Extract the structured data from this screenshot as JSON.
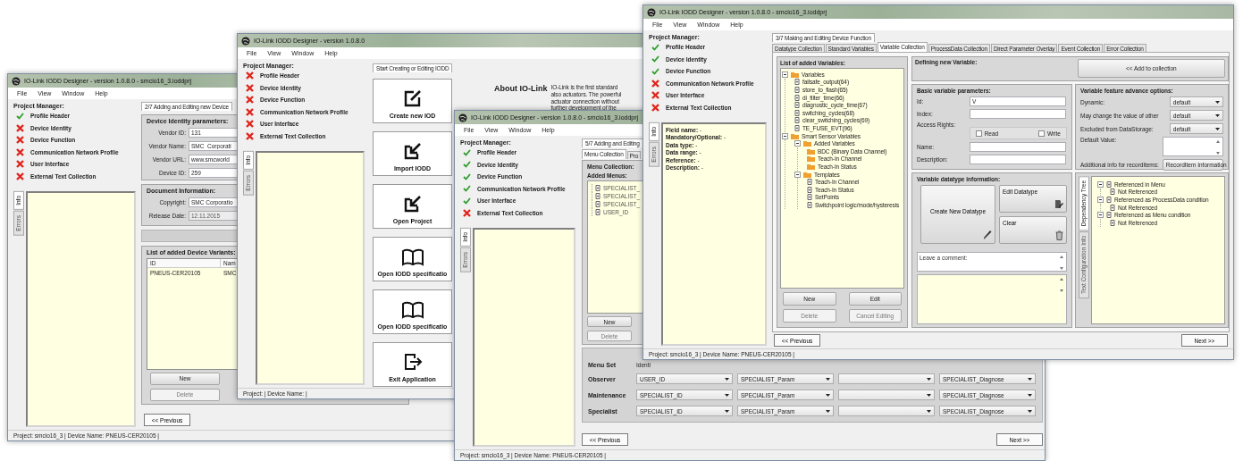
{
  "windows": [
    {
      "kind": "device_identity",
      "title": "IO-Link IODD Designer - version 1.0.8.0 - smcio16_3.ioddprj",
      "menu": [
        "File",
        "View",
        "Window",
        "Help"
      ],
      "project_manager": {
        "heading": "Project Manager:",
        "items": [
          {
            "label": "Profile Header",
            "done": true
          },
          {
            "label": "Device Identity",
            "done": false
          },
          {
            "label": "Device Function",
            "done": false
          },
          {
            "label": "Communication Network Profile",
            "done": false
          },
          {
            "label": "User Interface",
            "done": false
          },
          {
            "label": "External Text Collection",
            "done": false
          }
        ]
      },
      "side_tabs": [
        {
          "label": "Info",
          "selected": true
        },
        {
          "label": "Errors",
          "selected": false
        }
      ],
      "step": "2/7 Adding and Editing new Device",
      "identity": {
        "heading": "Device Identity parameters:",
        "fields": [
          {
            "label": "Vendor ID:",
            "value": "131",
            "disabled": false
          },
          {
            "label": "Vendor Name:",
            "value": "SMC_Corporati",
            "disabled": false
          },
          {
            "label": "Vendor URL:",
            "value": "www.smcworld",
            "disabled": false
          },
          {
            "label": "Device ID:",
            "value": "259",
            "disabled": false
          }
        ]
      },
      "document": {
        "heading": "Document Information:",
        "fields": [
          {
            "label": "Copyright:",
            "value": "SMC Corporatio",
            "disabled": false
          },
          {
            "label": "Release Date:",
            "value": "12.11.2015",
            "disabled": true
          }
        ]
      },
      "variants": {
        "heading": "List of added Device Variants:",
        "columns": [
          "ID",
          "Nam"
        ],
        "rows": [
          [
            "PNEUS-CER20105",
            "SMC"
          ]
        ]
      },
      "buttons": [
        {
          "label": "New",
          "disabled": false
        },
        {
          "label": "Delete",
          "disabled": true
        }
      ],
      "previous": "<< Previous",
      "status": "Project: smcio16_3 | Device Name: PNEUS-CER20105 |"
    },
    {
      "kind": "start",
      "title": "IO-Link IODD Designer - version 1.0.8.0",
      "menu": [
        "File",
        "View",
        "Window",
        "Help"
      ],
      "project_manager": {
        "heading": "Project Manager:",
        "items": [
          {
            "label": "Profile Header",
            "done": false
          },
          {
            "label": "Device Identity",
            "done": false
          },
          {
            "label": "Device Function",
            "done": false
          },
          {
            "label": "Communication Network Profile",
            "done": false
          },
          {
            "label": "User Interface",
            "done": false
          },
          {
            "label": "External Text Collection",
            "done": false
          }
        ]
      },
      "side_tabs": [
        {
          "label": "Info",
          "selected": true
        },
        {
          "label": "Errors",
          "selected": false
        }
      ],
      "tab": "Start Creating or Editing IODD",
      "actions": [
        "Create new IOD",
        "Import IODD",
        "Open Project",
        "Open IODD specificatio",
        "Open IODD specificatio",
        "Exit Application"
      ],
      "about": {
        "heading": "About IO-Link",
        "lines": [
          "IO-Link is the first standard",
          "also actuators. The powerful",
          "actuator connection without",
          "further development of the"
        ]
      },
      "status": "Project: | Device Name: |"
    },
    {
      "kind": "menu_collection",
      "title": "IO-Link IODD Designer - version 1.0.8.0 - smcio16_3.ioddprj",
      "menu": [
        "File",
        "View",
        "Window",
        "Help"
      ],
      "project_manager": {
        "heading": "Project Manager:",
        "items": [
          {
            "label": "Profile Header",
            "done": true
          },
          {
            "label": "Device Identity",
            "done": true
          },
          {
            "label": "Device Function",
            "done": true
          },
          {
            "label": "Communication Network Profile",
            "done": true
          },
          {
            "label": "User Interface",
            "done": true
          },
          {
            "label": "External Text Collection",
            "done": false
          }
        ]
      },
      "side_tabs": [
        {
          "label": "Info",
          "selected": true
        },
        {
          "label": "Errors",
          "selected": false
        }
      ],
      "step": "5/7 Adding and Editing",
      "tabs": [
        {
          "label": "Menu Collection",
          "selected": true
        },
        {
          "label": "Pro",
          "selected": false
        }
      ],
      "collection": {
        "heading": "Menu Collection:",
        "subheading": "Added Menus:",
        "items": [
          "SPECIALIST_",
          "SPECIALIST_",
          "SPECIALIST_",
          "USER_ID"
        ]
      },
      "buttons": [
        {
          "label": "New",
          "disabled": false
        },
        {
          "label": "Delete",
          "disabled": true
        }
      ],
      "menu_set": {
        "heading": "Menu Set",
        "column": "Identi",
        "rows": [
          {
            "role": "Observer",
            "selections": [
              {
                "kind": "value",
                "value": "USER_ID"
              },
              {
                "kind": "value",
                "value": "SPECIALIST_Param"
              },
              {
                "kind": "blank"
              },
              {
                "kind": "value",
                "value": "SPECIALIST_Diagnose"
              }
            ]
          },
          {
            "role": "Maintenance",
            "selections": [
              {
                "kind": "value",
                "value": "SPECIALIST_ID"
              },
              {
                "kind": "value",
                "value": "SPECIALIST_Param"
              },
              {
                "kind": "blank"
              },
              {
                "kind": "value",
                "value": "SPECIALIST_Diagnose"
              }
            ]
          },
          {
            "role": "Specialist",
            "selections": [
              {
                "kind": "value",
                "value": "SPECIALIST_ID"
              },
              {
                "kind": "value",
                "value": "SPECIALIST_Param"
              },
              {
                "kind": "blank"
              },
              {
                "kind": "value",
                "value": "SPECIALIST_Diagnose"
              }
            ]
          }
        ]
      },
      "previous": "<< Previous",
      "next": "Next >>",
      "status": "Project: smcio16_3 | Device Name: PNEUS-CER20105 |"
    },
    {
      "kind": "variable_collection",
      "title": "IO-Link IODD Designer - version 1.0.8.0 - smcio16_3.ioddprj",
      "menu": [
        "File",
        "View",
        "Window",
        "Help"
      ],
      "project_manager": {
        "heading": "Project Manager:",
        "items": [
          {
            "label": "Profile Header",
            "done": true
          },
          {
            "label": "Device Identity",
            "done": true
          },
          {
            "label": "Device Function",
            "done": true
          },
          {
            "label": "Communication Network Profile",
            "done": false
          },
          {
            "label": "User Interface",
            "done": false
          },
          {
            "label": "External Text Collection",
            "done": false
          }
        ]
      },
      "side_tabs": [
        {
          "label": "Info",
          "selected": true
        },
        {
          "label": "Errors",
          "selected": false
        }
      ],
      "info_lines": [
        "**Field name:** -",
        "**Mandatory/Optional:** -",
        "**Data type:** -",
        "**Data range:** -",
        "**Reference:** -",
        "**Description:** -"
      ],
      "step": "3/7 Making and Editing Device Function",
      "tabs": [
        {
          "label": "Datatype Collection",
          "selected": false
        },
        {
          "label": "Standard Variables",
          "selected": false
        },
        {
          "label": "Variable Collection",
          "selected": true
        },
        {
          "label": "ProcessData Collection",
          "selected": false
        },
        {
          "label": "Direct Parameter Overlay",
          "selected": false
        },
        {
          "label": "Event Collection",
          "selected": false
        },
        {
          "label": "Error Collection",
          "selected": false
        }
      ],
      "variables": {
        "heading": "List of added Variables:",
        "tree": [
          {
            "kind": "folder",
            "label": "Variables",
            "children": [
              {
                "kind": "item",
                "label": "failsafe_output(64)"
              },
              {
                "kind": "item",
                "label": "store_to_flash(65)"
              },
              {
                "kind": "item",
                "label": "di_filter_time(66)"
              },
              {
                "kind": "item",
                "label": "diagnostic_cycle_time(67)"
              },
              {
                "kind": "item",
                "label": "switching_cycles(68)"
              },
              {
                "kind": "item",
                "label": "clear_switching_cycles(69)"
              },
              {
                "kind": "item",
                "label": "TE_FUSE_EVT(96)"
              }
            ]
          },
          {
            "kind": "folder",
            "label": "Smart Sensor Variables",
            "children": [
              {
                "kind": "folder",
                "label": "Added Variables",
                "children": [
                  {
                    "kind": "folder",
                    "label": "BDC (Binary Data Channel)"
                  },
                  {
                    "kind": "folder",
                    "label": "Teach-In Channel"
                  },
                  {
                    "kind": "folder",
                    "label": "Teach-In Status"
                  }
                ]
              },
              {
                "kind": "folder",
                "label": "Templates",
                "children": [
                  {
                    "kind": "item",
                    "label": "Teach-In Channel"
                  },
                  {
                    "kind": "item",
                    "label": "Teach-In Status"
                  },
                  {
                    "kind": "item",
                    "label": "SetPoints"
                  },
                  {
                    "kind": "item",
                    "label": "Switchpoint logic/mode/hysteresis"
                  }
                ]
              }
            ]
          }
        ]
      },
      "buttons": [
        {
          "label": "New",
          "disabled": false
        },
        {
          "label": "Edit",
          "disabled": false
        },
        {
          "label": "Delete",
          "disabled": true
        },
        {
          "label": "Cancel Editing",
          "disabled": true
        }
      ],
      "define": {
        "heading": "Defining new Variable:",
        "add_button": "<< Add to collection"
      },
      "basic": {
        "heading": "Basic variable parameters:",
        "rows": [
          {
            "kind": "text",
            "label": "Id:",
            "value": "V_"
          },
          {
            "kind": "text",
            "label": "Index:"
          },
          {
            "kind": "access",
            "label": "Access Rights:",
            "options": [
              {
                "label": "Read",
                "checked": false
              },
              {
                "label": "Write",
                "checked": false
              }
            ]
          },
          {
            "kind": "text",
            "label": "Name:"
          },
          {
            "kind": "text",
            "label": "Description:"
          }
        ]
      },
      "advanced": {
        "heading": "Variable feature advance options:",
        "selects": [
          {
            "label": "Dynamic:",
            "value": "default"
          },
          {
            "label": "May change the value of other",
            "value": "default"
          },
          {
            "label": "Excluded from DataStorage:",
            "value": "default"
          }
        ],
        "default_label": "Default Value:",
        "record_label": "Additional info for recorditems:",
        "record_button": "RecordItem Information"
      },
      "datatype": {
        "heading": "Variable datatype information:",
        "create": "Create New Datatype",
        "edit": "Edit Datatype",
        "clear": "Clear",
        "comment_placeholder": "Leave a comment:"
      },
      "dependency": {
        "tabs": [
          {
            "label": "Dependency Tree",
            "selected": true
          },
          {
            "label": "Text Configuration Info",
            "selected": false
          }
        ],
        "tree": [
          {
            "kind": "item",
            "label": "Referenced in Menu",
            "children": [
              {
                "kind": "item",
                "label": "Not Referenced"
              }
            ]
          },
          {
            "kind": "item",
            "label": "Referenced as ProcessData condition",
            "children": [
              {
                "kind": "item",
                "label": "Not Referenced"
              }
            ]
          },
          {
            "kind": "item",
            "label": "Referenced as Menu condition",
            "children": [
              {
                "kind": "item",
                "label": "Not Referenced"
              }
            ]
          }
        ]
      },
      "previous": "<< Previous",
      "next": "Next >>",
      "status": "Project: smcio16_3 | Device Name: PNEUS-CER20105 |"
    }
  ]
}
